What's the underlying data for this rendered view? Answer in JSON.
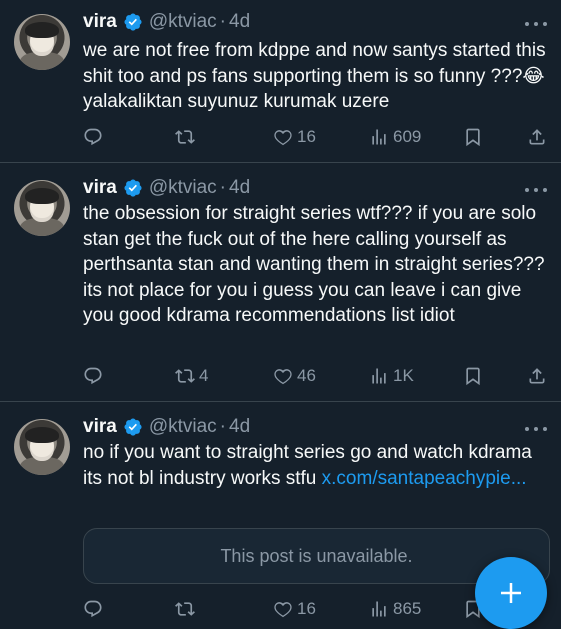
{
  "tweets": [
    {
      "name": "vira",
      "handle": "@ktviac",
      "separator": "·",
      "time": "4d",
      "text": "we are not free from kdppe and now santys started this shit too and ps fans supporting them is so funny ???😂 yalakaliktan suyunuz kurumak uzere",
      "reply_count": "",
      "retweet_count": "",
      "like_count": "16",
      "view_count": "609"
    },
    {
      "name": "vira",
      "handle": "@ktviac",
      "separator": "·",
      "time": "4d",
      "text": "the obsession for straight series wtf??? if you are solo stan get the fuck out of the here calling yourself as perthsanta stan and wanting them in straight series??? its not place for you i guess you can leave i can give you good kdrama recommendations list idiot",
      "reply_count": "",
      "retweet_count": "4",
      "like_count": "46",
      "view_count": "1K"
    },
    {
      "name": "vira",
      "handle": "@ktviac",
      "separator": "·",
      "time": "4d",
      "text": "no if you want to straight series go and watch kdrama its not bl industry works stfu ",
      "link": "x.com/santapeachypie...",
      "quote_unavailable": "This post is unavailable.",
      "reply_count": "",
      "retweet_count": "",
      "like_count": "16",
      "view_count": "865"
    }
  ],
  "icons": {
    "verified": "verified-badge-icon",
    "reply": "reply-icon",
    "retweet": "retweet-icon",
    "like": "heart-icon",
    "views": "views-bar-chart-icon",
    "bookmark": "bookmark-icon",
    "share": "share-icon",
    "compose": "plus-icon"
  },
  "colors": {
    "background": "#15202b",
    "accent": "#1d9bf0",
    "secondary_text": "#8b98a5",
    "divider": "#38444d"
  }
}
